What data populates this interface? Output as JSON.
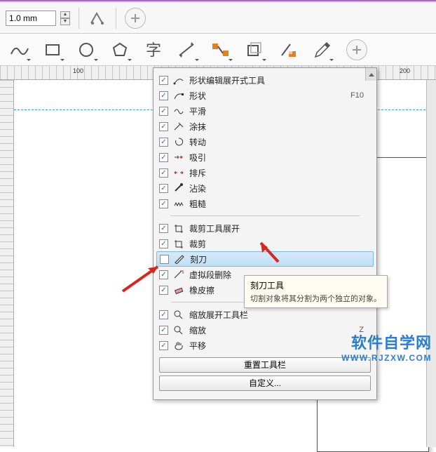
{
  "toolbar": {
    "stroke_width": "1.0 mm"
  },
  "ruler": {
    "mark_100": "100",
    "mark_200": "200"
  },
  "menu": {
    "group1": [
      {
        "label": "形状编辑展开式工具",
        "shortcut": ""
      },
      {
        "label": "形状",
        "shortcut": "F10"
      },
      {
        "label": "平滑",
        "shortcut": ""
      },
      {
        "label": "涂抹",
        "shortcut": ""
      },
      {
        "label": "转动",
        "shortcut": ""
      },
      {
        "label": "吸引",
        "shortcut": ""
      },
      {
        "label": "排斥",
        "shortcut": ""
      },
      {
        "label": "沾染",
        "shortcut": ""
      },
      {
        "label": "粗糙",
        "shortcut": ""
      }
    ],
    "group2": [
      {
        "label": "裁剪工具展开",
        "shortcut": ""
      },
      {
        "label": "裁剪",
        "shortcut": ""
      },
      {
        "label": "刻刀",
        "shortcut": "",
        "selected": true
      },
      {
        "label": "虚拟段删除",
        "shortcut": ""
      },
      {
        "label": "橡皮擦",
        "shortcut": ""
      }
    ],
    "group3": [
      {
        "label": "缩放展开工具栏",
        "shortcut": ""
      },
      {
        "label": "缩放",
        "shortcut": "Z"
      },
      {
        "label": "平移",
        "shortcut": ""
      }
    ],
    "reset_btn": "重置工具栏",
    "custom_btn": "自定义..."
  },
  "tooltip": {
    "title": "刻刀工具",
    "desc": "切割对象将其分割为两个独立的对象。"
  },
  "watermark": {
    "line1": "软件自学网",
    "line2": "WWW.RJZXW.COM"
  }
}
